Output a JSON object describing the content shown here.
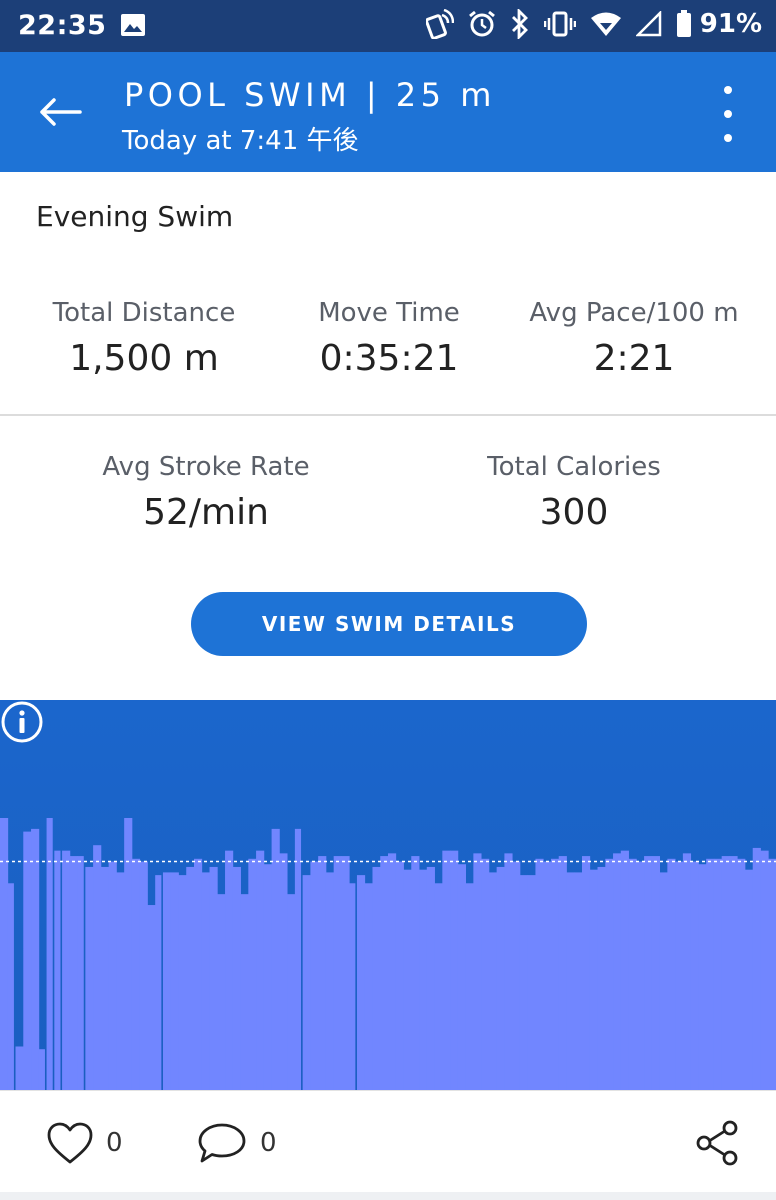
{
  "status_bar": {
    "time": "22:35",
    "battery": "91%",
    "icons": [
      "gallery-icon",
      "nfc-icon",
      "alarm-icon",
      "bluetooth-icon",
      "vibrate-icon",
      "wifi-icon",
      "signal-icon",
      "battery-icon"
    ]
  },
  "header": {
    "title": "POOL SWIM | 25 m",
    "subtitle": "Today at 7:41 午後",
    "back_icon": "arrow-left-icon",
    "menu_icon": "more-vert-icon",
    "background": "#1e73d6"
  },
  "activity": {
    "name": "Evening Swim"
  },
  "stats": {
    "total_distance": {
      "label": "Total Distance",
      "value": "1,500 m"
    },
    "move_time": {
      "label": "Move Time",
      "value": "0:35:21"
    },
    "avg_pace": {
      "label": "Avg Pace/100 m",
      "value": "2:21"
    },
    "avg_stroke_rate": {
      "label": "Avg Stroke Rate",
      "value": "52/min"
    },
    "total_calories": {
      "label": "Total Calories",
      "value": "300"
    }
  },
  "details_button": {
    "label": "VIEW SWIM DETAILS"
  },
  "chart_data": {
    "type": "bar",
    "values": [
      100,
      76,
      16,
      95,
      96,
      15,
      100,
      88,
      88,
      86,
      86,
      82,
      90,
      82,
      84,
      80,
      100,
      85,
      84,
      68,
      79,
      80,
      80,
      79,
      82,
      85,
      80,
      82,
      72,
      88,
      82,
      72,
      85,
      88,
      83,
      96,
      87,
      72,
      96,
      79,
      84,
      86,
      80,
      86,
      86,
      76,
      79,
      76,
      82,
      86,
      87,
      84,
      81,
      86,
      81,
      82,
      76,
      88,
      88,
      83,
      76,
      87,
      85,
      80,
      82,
      87,
      84,
      79,
      79,
      85,
      84,
      85,
      86,
      80,
      80,
      86,
      81,
      82,
      85,
      87,
      88,
      85,
      84,
      86,
      86,
      80,
      85,
      84,
      87,
      84,
      83,
      85,
      85,
      86,
      86,
      85,
      81,
      89,
      88,
      85
    ],
    "average": 84,
    "gaps_after_index": [
      1,
      5,
      6,
      7,
      10,
      20,
      38,
      45
    ],
    "bar_color": "#7186ff",
    "background_color": "#1b66cc",
    "average_line_color": "#ffffff",
    "info_icon": "info-icon"
  },
  "footer": {
    "likes": "0",
    "comments": "0",
    "like_icon": "heart-icon",
    "comment_icon": "comment-icon",
    "share_icon": "share-icon"
  }
}
